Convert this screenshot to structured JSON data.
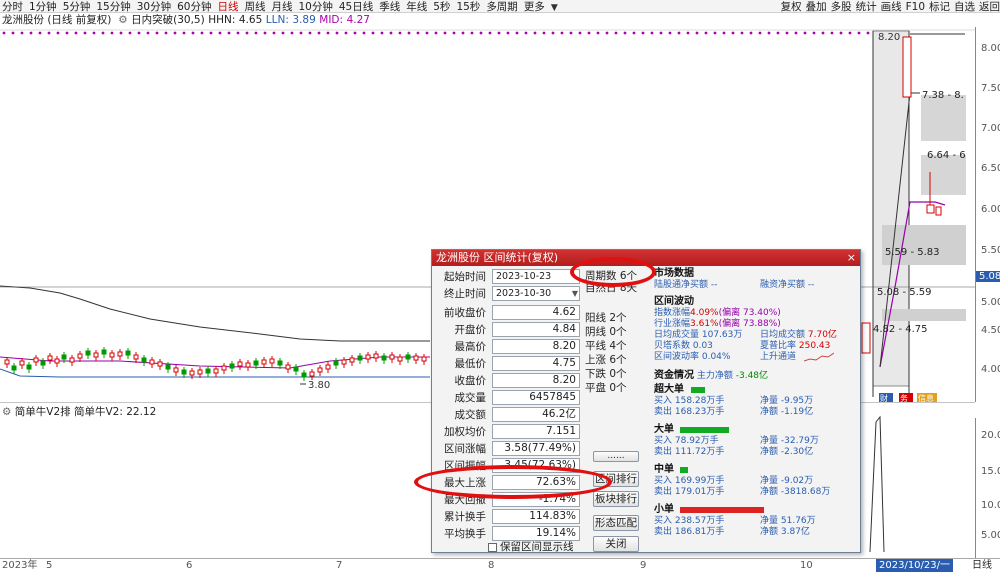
{
  "toolbar": {
    "periods": [
      "分时",
      "1分钟",
      "5分钟",
      "15分钟",
      "30分钟",
      "60分钟",
      "日线",
      "周线",
      "月线",
      "10分钟",
      "45日线",
      "季线",
      "年线",
      "5秒",
      "15秒",
      "多周期",
      "更多"
    ],
    "active_period": "日线",
    "right_tools": [
      "复权",
      "叠加",
      "多股",
      "统计",
      "画线",
      "F10",
      "标记",
      "自选",
      "返回"
    ],
    "accent": "#d40000"
  },
  "chart_header": {
    "stock": "龙洲股份 (日线 前复权)",
    "indicator": "日内突破(30,5)",
    "hhn_label": "HHN:",
    "hhn_value": "4.65",
    "lln_label": "LLN:",
    "lln_value": "3.89",
    "mid_label": "MID:",
    "mid_value": "4.27"
  },
  "price_axis": [
    "8.00",
    "7.50",
    "7.00",
    "6.50",
    "6.00",
    "5.50",
    "5.08",
    "5.00",
    "4.50",
    "4.00"
  ],
  "chart_annotations": {
    "low_marker": "3.80",
    "top_marker": "8.20",
    "range_1": "7.38 - 8.",
    "range_2": "6.64 - 6",
    "range_3": "5.59 - 5.83",
    "range_4": "5.08 - 5.59",
    "range_5": "4.82 - 4.75",
    "tags": [
      "财",
      "务",
      "信息"
    ]
  },
  "sub_chart": {
    "title": "简单牛V2排  简单牛V2: 22.12",
    "axis": [
      "20.00",
      "15.00",
      "10.00",
      "5.00"
    ]
  },
  "date_axis": {
    "ticks": [
      "2023年",
      "5",
      "6",
      "7",
      "8",
      "9",
      "10"
    ],
    "cursor_date": "2023/10/23/一",
    "right_label": "日线"
  },
  "dialog": {
    "title": "龙洲股份 区间统计(复权)",
    "close": "×",
    "start_label": "起始时间",
    "start_value": "2023-10-23",
    "end_label": "终止时间",
    "end_value": "2023-10-30",
    "fields": [
      {
        "label": "前收盘价",
        "value": "4.62"
      },
      {
        "label": "开盘价",
        "value": "4.84"
      },
      {
        "label": "最高价",
        "value": "8.20"
      },
      {
        "label": "最低价",
        "value": "4.75"
      },
      {
        "label": "收盘价",
        "value": "8.20"
      },
      {
        "label": "成交量",
        "value": "6457845"
      },
      {
        "label": "成交额",
        "value": "46.2亿"
      },
      {
        "label": "加权均价",
        "value": "7.151"
      },
      {
        "label": "区间涨幅",
        "value": "3.58(77.49%)"
      },
      {
        "label": "区间振幅",
        "value": "3.45(72.63%)"
      },
      {
        "label": "最大上涨",
        "value": "72.63%"
      },
      {
        "label": "最大回撤",
        "value": "-1.74%"
      },
      {
        "label": "累计换手",
        "value": "114.83%"
      },
      {
        "label": "平均换手",
        "value": "19.14%"
      }
    ],
    "checkbox_label": "保留区间显示线",
    "periods_count": "周期数 6个",
    "natural_days": "自然日 8天",
    "counts": [
      "阳线 2个",
      "阴线 0个",
      "平线 4个",
      "上涨 6个",
      "下跌 0个",
      "平盘 0个"
    ],
    "buttons": [
      "......",
      "区间排行",
      "板块排行",
      "形态匹配",
      "关闭"
    ],
    "market": {
      "header": "市场数据",
      "lugu": "陆股通净买额 --",
      "rongzi": "融资净买额 --",
      "wave_header": "区间波动",
      "index_label": "指数涨幅",
      "index_value": "4.09%",
      "index_dev": "(偏离 73.40%)",
      "industry_label": "行业涨幅",
      "industry_value": "3.61%",
      "industry_dev": "(偏离 73.88%)",
      "avg_vol": "日均成交量 107.63万",
      "avg_amt_label": "日均成交额",
      "avg_amt_value": "7.70亿",
      "beta": "贝塔系数 0.03",
      "sharpe_label": "夏普比率",
      "sharpe_value": "250.43",
      "vol": "区间波动率 0.04%",
      "trend": "上升通道",
      "capital_header": "资金情况",
      "main_net_label": "主力净额",
      "main_net_value": "-3.48亿",
      "groups": [
        {
          "name": "超大单",
          "buy": "158.28万手",
          "sell": "168.23万手",
          "net_buy": "-9.95万",
          "net_amt": "-1.19亿",
          "bar_color": "#11aa22",
          "bar_frac": 0.1
        },
        {
          "name": "大单",
          "buy": "78.92万手",
          "sell": "111.72万手",
          "net_buy": "-32.79万",
          "net_amt": "-2.30亿",
          "bar_color": "#11aa22",
          "bar_frac": 0.35
        },
        {
          "name": "中单",
          "buy": "169.99万手",
          "sell": "179.01万手",
          "net_buy": "-9.02万",
          "net_amt": "-3818.68万",
          "bar_color": "#11aa22",
          "bar_frac": 0.06
        },
        {
          "name": "小单",
          "buy": "238.57万手",
          "sell": "186.81万手",
          "net_buy": "51.76万",
          "net_amt": "3.87亿",
          "bar_color": "#dd2222",
          "bar_frac": 0.6
        }
      ],
      "buy_label": "买入",
      "sell_label": "卖出",
      "net_label": "净量",
      "net_amt_label": "净额"
    }
  }
}
